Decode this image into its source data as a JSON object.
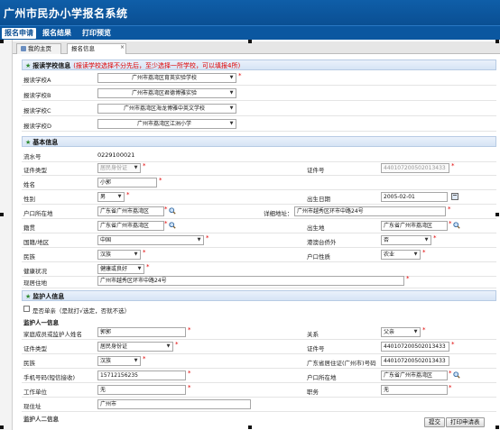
{
  "app": {
    "title": "广州市民办小学报名系统"
  },
  "menu": {
    "items": [
      "报名申请",
      "报名结果",
      "打印预览"
    ]
  },
  "tabs": {
    "home": "我的主页",
    "current": "报名信息"
  },
  "school_section": {
    "title": "报读学校信息",
    "note": "(报读学校选择不分先后，至少选择一所学校，可以填报4所)",
    "rows": [
      {
        "label": "报读学校A",
        "value": "广州市荔湾区育英实验学校"
      },
      {
        "label": "报读学校B",
        "value": "广州市荔湾区君德博雅实验"
      },
      {
        "label": "报读学校C",
        "value": "广州市荔湾区海龙博雅中英文学校"
      },
      {
        "label": "报读学校D",
        "value": "广州市荔湾区江洲小学"
      }
    ]
  },
  "basic_section": {
    "title": "基本信息",
    "serial_label": "流水号",
    "serial_value": "0229100021",
    "idtype_label": "证件类型",
    "idtype_value": "居民身份证",
    "idno_label": "证件号",
    "idno_value": "440107200502013433",
    "name_label": "姓名",
    "name_value": "小郭",
    "gender_label": "性别",
    "gender_value": "男",
    "birth_label": "出生日期",
    "birth_value": "2005-02-01",
    "hukou_label": "户口所在地",
    "hukou_value": "广东省广州市荔湾区",
    "address_label": "详细地址：",
    "address_value": "广州市越秀区环市中路24号",
    "native_label": "籍贯",
    "native_value": "广东省广州市荔湾区",
    "birthplace_label": "出生地",
    "birthplace_value": "广东省广州市荔湾区",
    "country_label": "国籍/地区",
    "country_value": "中国",
    "hkmo_label": "港澳台侨外",
    "hkmo_value": "否",
    "ethnic_label": "民族",
    "ethnic_value": "汉族",
    "hukoutype_label": "户口性质",
    "hukoutype_value": "农业",
    "health_label": "健康状况",
    "health_value": "健康或良好",
    "residence_label": "现居住地",
    "residence_value": "广州市越秀区环市中路24号"
  },
  "guardian_section": {
    "title": "监护人信息",
    "single_parent_label": "是否单亲（是就打√选定，否就不选）",
    "sub_title": "监护人一信息",
    "g_name_label": "家庭成员或监护人姓名",
    "g_name_value": "郭郭",
    "relation_label": "关系",
    "relation_value": "父亲",
    "g_idtype_label": "证件类型",
    "g_idtype_value": "居民身份证",
    "g_idno_label": "证件号",
    "g_idno_value": "440107200502013433",
    "g_ethnic_label": "民族",
    "g_ethnic_value": "汉族",
    "g_gdid_label": "广东省居住证(广州市)号码",
    "g_gdid_value": "440107200502013433",
    "phone_label": "手机号码(短信接收)",
    "phone_value": "15712156235",
    "g_hukou_label": "户口所在地",
    "g_hukou_value": "广东省广州市荔湾区",
    "work_label": "工作单位",
    "work_value": "无",
    "job_label": "职务",
    "job_value": "无",
    "now_addr_label": "现住址",
    "now_addr_value": "广州市",
    "sub_title2": "监护人二信息"
  },
  "buttons": {
    "submit": "提交",
    "print": "打印申请表"
  },
  "colors": {
    "header_blue": "#0b57a0",
    "required_red": "#e00000",
    "section_bg": "#d6e4f5"
  }
}
